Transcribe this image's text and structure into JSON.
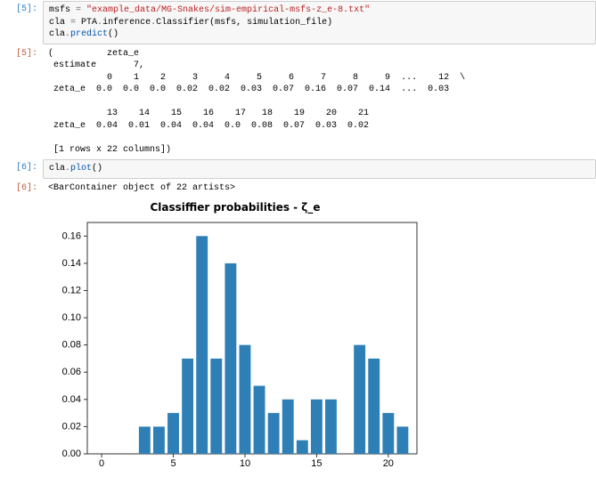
{
  "cells": {
    "in5": {
      "prompt": "[5]:",
      "line1_var": "msfs",
      "line1_eq": " = ",
      "line1_str": "\"example_data/MG-Snakes/sim-empirical-msfs-z_e-8.txt\"",
      "line2_var": "cla",
      "line2_eq": " = ",
      "line2_mod": "PTA",
      "line2_dot1": ".",
      "line2_a1": "inference",
      "line2_dot2": ".",
      "line2_a2": "Classifier",
      "line2_args": "(msfs, simulation_file)",
      "line3_var": "cla",
      "line3_dot": ".",
      "line3_call": "predict",
      "line3_args": "()"
    },
    "out5": {
      "prompt": "[5]:",
      "text": "(          zeta_e\n estimate       7,\n           0    1    2     3     4     5     6     7     8     9  ...    12  \\\n zeta_e  0.0  0.0  0.0  0.02  0.02  0.03  0.07  0.16  0.07  0.14  ...  0.03   \n \n           13    14    15    16    17   18    19    20    21  \n zeta_e  0.04  0.01  0.04  0.04  0.0  0.08  0.07  0.03  0.02  \n \n [1 rows x 22 columns])"
    },
    "in6": {
      "prompt": "[6]:",
      "var": "cla",
      "dot": ".",
      "call": "plot",
      "args": "()"
    },
    "out6": {
      "prompt": "[6]:",
      "text": "<BarContainer object of 22 artists>"
    }
  },
  "chart_data": {
    "type": "bar",
    "title": "Classiffier probabilities - ζ_e",
    "xlabel": "",
    "ylabel": "",
    "xlim": [
      -1,
      22
    ],
    "ylim": [
      0.0,
      0.17
    ],
    "xticks": [
      0,
      5,
      10,
      15,
      20
    ],
    "yticks": [
      0.0,
      0.02,
      0.04,
      0.06,
      0.08,
      0.1,
      0.12,
      0.14,
      0.16
    ],
    "categories": [
      0,
      1,
      2,
      3,
      4,
      5,
      6,
      7,
      8,
      9,
      10,
      11,
      12,
      13,
      14,
      15,
      16,
      17,
      18,
      19,
      20,
      21
    ],
    "values": [
      0.0,
      0.0,
      0.0,
      0.02,
      0.02,
      0.03,
      0.07,
      0.16,
      0.07,
      0.14,
      0.08,
      0.05,
      0.03,
      0.04,
      0.01,
      0.04,
      0.04,
      0.0,
      0.08,
      0.07,
      0.03,
      0.02
    ]
  }
}
